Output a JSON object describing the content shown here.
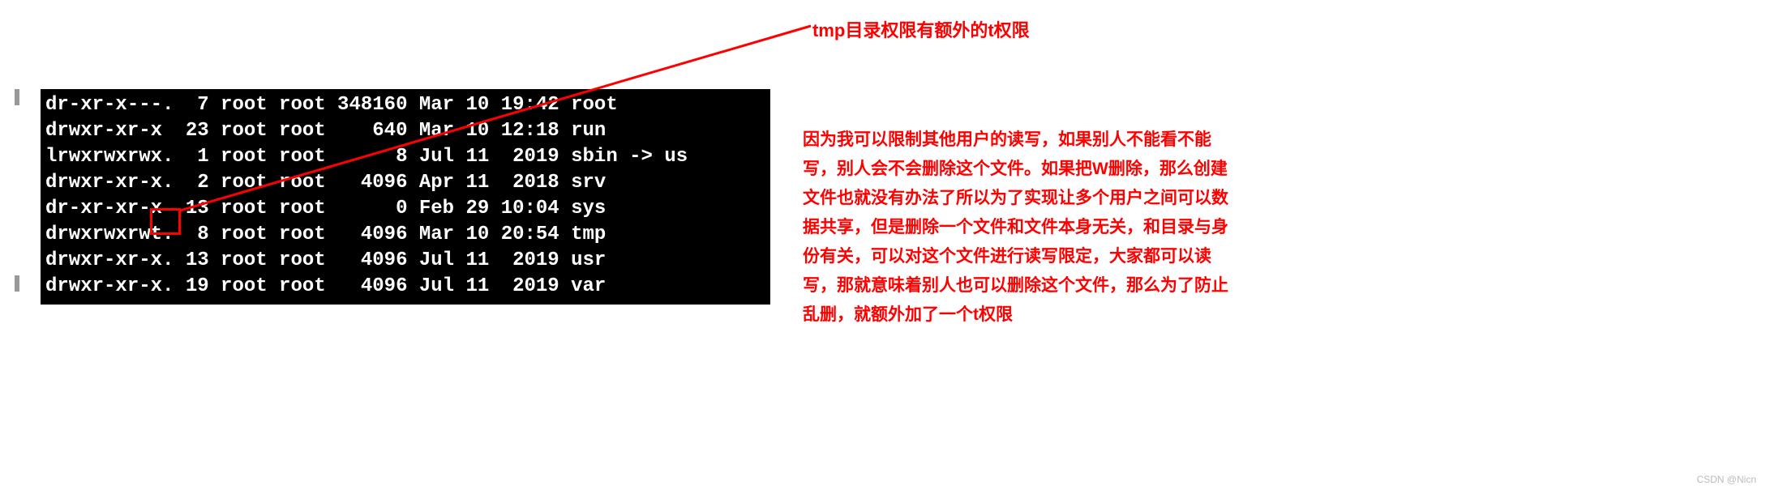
{
  "terminal": {
    "rows": [
      {
        "perm": "dr-xr-x---.",
        "links": " 7",
        "owner": "root",
        "group": "root",
        "size": "348160",
        "month": "Mar",
        "day": "10",
        "time": "19:42",
        "name": "root",
        "bold": true,
        "link": ""
      },
      {
        "perm": "drwxr-xr-x ",
        "links": "23",
        "owner": "root",
        "group": "root",
        "size": "   640",
        "month": "Mar",
        "day": "10",
        "time": "12:18",
        "name": "run",
        "bold": true,
        "link": ""
      },
      {
        "perm": "lrwxrwxrwx.",
        "links": " 1",
        "owner": "root",
        "group": "root",
        "size": "     8",
        "month": "Jul",
        "day": "11",
        "time": " 2019",
        "name": "sbin",
        "bold": true,
        "link": " -> us"
      },
      {
        "perm": "drwxr-xr-x.",
        "links": " 2",
        "owner": "root",
        "group": "root",
        "size": "  4096",
        "month": "Apr",
        "day": "11",
        "time": " 2018",
        "name": "srv",
        "bold": true,
        "link": ""
      },
      {
        "perm": "dr-xr-xr-x ",
        "links": "13",
        "owner": "root",
        "group": "root",
        "size": "     0",
        "month": "Feb",
        "day": "29",
        "time": "10:04",
        "name": "sys",
        "bold": true,
        "link": ""
      },
      {
        "perm": "drwxrwxrwt.",
        "links": " 8",
        "owner": "root",
        "group": "root",
        "size": "  4096",
        "month": "Mar",
        "day": "10",
        "time": "20:54",
        "name": "tmp",
        "bold": false,
        "link": ""
      },
      {
        "perm": "drwxr-xr-x.",
        "links": "13",
        "owner": "root",
        "group": "root",
        "size": "  4096",
        "month": "Jul",
        "day": "11",
        "time": " 2019",
        "name": "usr",
        "bold": true,
        "link": ""
      },
      {
        "perm": "drwxr-xr-x.",
        "links": "19",
        "owner": "root",
        "group": "root",
        "size": "  4096",
        "month": "Jul",
        "day": "11",
        "time": " 2019",
        "name": "var",
        "bold": true,
        "link": ""
      }
    ]
  },
  "annotation": {
    "title": "tmp目录权限有额外的t权限",
    "body": "因为我可以限制其他用户的读写，如果别人不能看不能写，别人会不会删除这个文件。如果把W删除，那么创建文件也就没有办法了所以为了实现让多个用户之间可以数据共享，但是删除一个文件和文件本身无关，和目录与身份有关，可以对这个文件进行读写限定，大家都可以读写，那就意味着别人也可以删除这个文件，那么为了防止乱删，就额外加了一个t权限"
  },
  "watermark": "CSDN @Nicn"
}
